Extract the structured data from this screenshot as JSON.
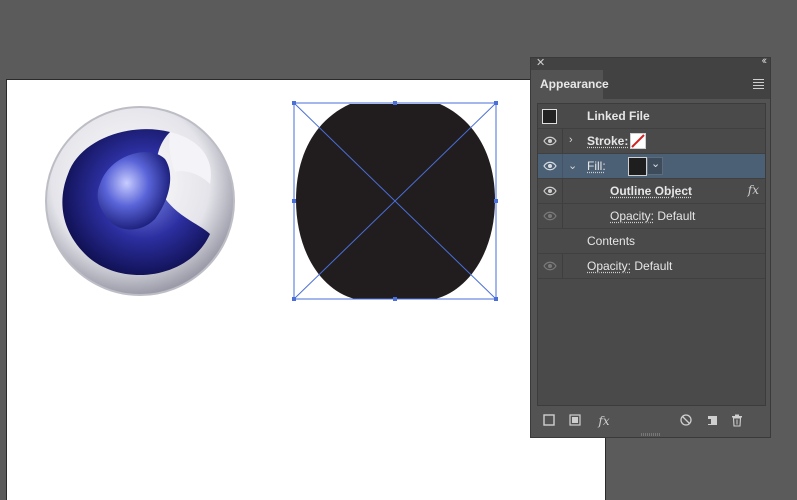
{
  "panel": {
    "title": "Appearance",
    "rows": {
      "linked_file": "Linked File",
      "stroke_label": "Stroke:",
      "fill_label": "Fill:",
      "outline_object": "Outline Object",
      "opacity1_label": "Opacity:",
      "opacity1_value": " Default",
      "contents": "Contents",
      "opacity2_label": "Opacity:",
      "opacity2_value": " Default"
    },
    "fx_glyph": "fx",
    "selected_row": "fill",
    "colors": {
      "selection_blue": "#4a6fd8",
      "selected_row": "#4c6075",
      "fill_swatch": "#1e1e1e"
    }
  },
  "icons": {
    "close": "close-icon",
    "collapse": "collapse-icon",
    "menu": "panel-menu-icon",
    "eye": "eye-icon",
    "new_stroke": "add-new-stroke-icon",
    "new_fill": "add-new-fill-icon",
    "add_effect": "add-effect-icon",
    "clear": "clear-appearance-icon",
    "duplicate": "duplicate-item-icon",
    "delete": "delete-icon"
  }
}
